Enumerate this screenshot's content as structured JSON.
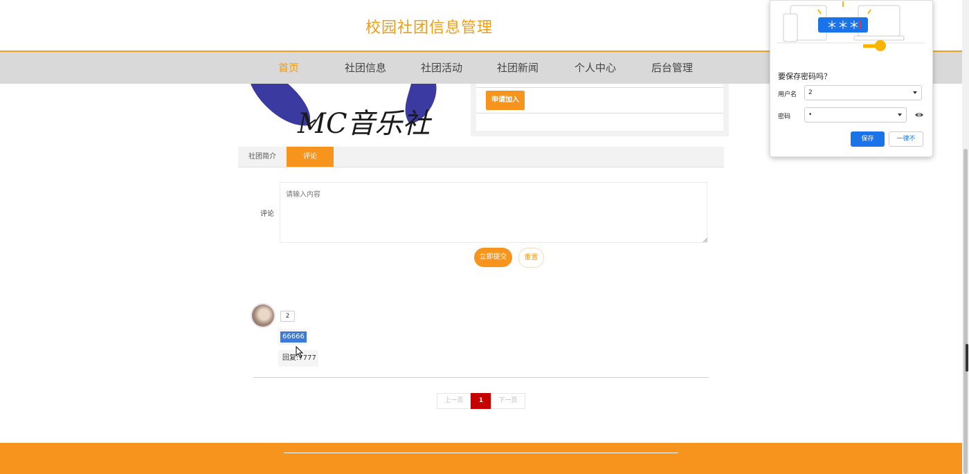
{
  "header": {
    "site_title": "校园社团信息管理"
  },
  "nav": {
    "items": [
      {
        "label": "首页",
        "active": true
      },
      {
        "label": "社团信息"
      },
      {
        "label": "社团活动"
      },
      {
        "label": "社团新闻"
      },
      {
        "label": "个人中心"
      },
      {
        "label": "后台管理"
      }
    ]
  },
  "club": {
    "logo_text": "MC音乐社",
    "join_label": "申请加入"
  },
  "tabs": [
    {
      "label": "社团简介"
    },
    {
      "label": "评论",
      "active": true
    }
  ],
  "comment_form": {
    "label": "评论",
    "placeholder": "请输入内容",
    "submit_label": "立即提交",
    "reset_label": "重置"
  },
  "comments": [
    {
      "user": "2",
      "content": "66666",
      "reply": "回复:7777"
    }
  ],
  "pagination": {
    "prev": "上一页",
    "current": "1",
    "next": "下一页"
  },
  "password_popup": {
    "title": "要保存密码吗？",
    "username_label": "用户名",
    "username_value": "2",
    "password_label": "密码",
    "password_value": "•",
    "save_label": "保存",
    "never_label": "一律不",
    "illustration_text": "＊＊＊"
  },
  "colors": {
    "accent": "#f7941d",
    "nav_bg": "#d9d9d9",
    "page_active": "#c40000",
    "popup_blue": "#1a73e8"
  }
}
